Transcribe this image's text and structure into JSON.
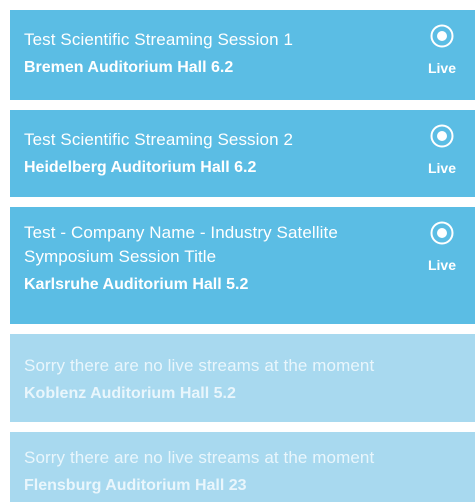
{
  "sessions": [
    {
      "title": "Test Scientific Streaming Session 1",
      "hall": "Bremen Auditorium Hall 6.2",
      "badge": "Live",
      "icon": "live-stream-icon",
      "status": "live"
    },
    {
      "title": "Test Scientific Streaming Session 2",
      "hall": "Heidelberg Auditorium Hall 6.2",
      "badge": "Live",
      "icon": "live-stream-icon",
      "status": "live"
    },
    {
      "title_line1": "Test - Company Name - Industry Satellite",
      "title_line2": "Symposium Session Title",
      "hall": "Karlsruhe Auditorium Hall 5.2",
      "badge": "Live",
      "icon": "live-stream-icon",
      "status": "live"
    },
    {
      "title": "Sorry there are no live streams at the moment",
      "hall": "Koblenz Auditorium Hall 5.2",
      "status": "offline"
    },
    {
      "title": "Sorry there are no live streams at the moment",
      "hall": "Flensburg Auditorium Hall 23",
      "status": "offline"
    }
  ],
  "colors": {
    "live_card": "#5bbde4",
    "offline_card": "#a8d9ef",
    "text": "#ffffff"
  }
}
